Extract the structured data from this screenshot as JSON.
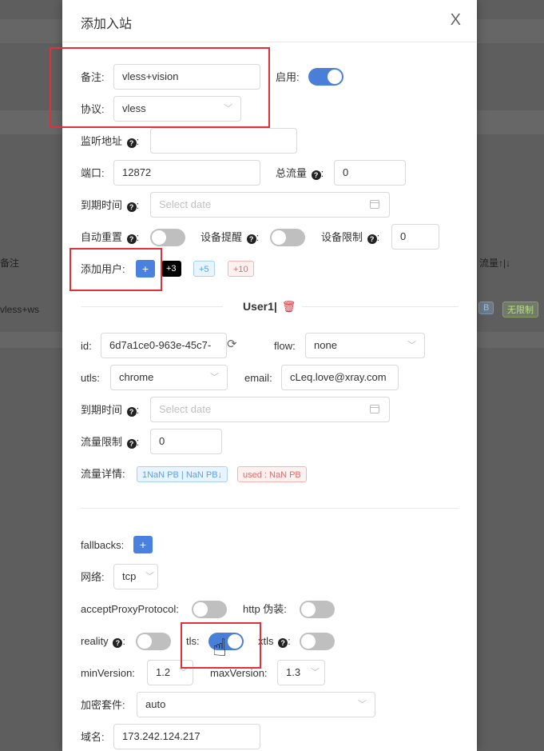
{
  "background": {
    "col_left_header": "备注",
    "col_right_header": "流量↑|↓",
    "row_left_value": "vless+ws",
    "row_tag_b": "B",
    "row_tag_unlimited": "无限制"
  },
  "modal": {
    "title": "添加入站",
    "close": "X",
    "remark_label": "备注:",
    "remark_value": "vless+vision",
    "enable_label": "启用:",
    "enable_on": true,
    "protocol_label": "协议:",
    "protocol_value": "vless",
    "listen_label": "监听地址",
    "listen_value": "",
    "port_label": "端口:",
    "port_value": "12872",
    "total_traffic_label": "总流量",
    "total_traffic_value": "0",
    "expiry_label": "到期时间",
    "expiry_placeholder": "Select date",
    "auto_reset_label": "自动重置",
    "device_alert_label": "设备提醒",
    "device_limit_label": "设备限制",
    "device_limit_value": "0",
    "add_user_label": "添加用户:",
    "add_btn": "+",
    "chip_plus3": "+3",
    "chip_plus5": "+5",
    "chip_plus10": "+10",
    "user_heading": "User1|",
    "id_label": "id:",
    "id_value": "6d7a1ce0-963e-45c7-",
    "flow_label": "flow:",
    "flow_value": "none",
    "utls_label": "utls:",
    "utls_value": "chrome",
    "email_label": "email:",
    "email_value": "cLeq.love@xray.com",
    "user_expiry_label": "到期时间",
    "user_expiry_placeholder": "Select date",
    "traffic_limit_label": "流量限制",
    "traffic_limit_value": "0",
    "traffic_detail_label": "流量详情:",
    "traffic_detail_chip": "1NaN PB | NaN PB↓",
    "used_chip": "used : NaN PB",
    "fallbacks_label": "fallbacks:",
    "network_label": "网络:",
    "network_value": "tcp",
    "accept_proxy_label": "acceptProxyProtocol:",
    "http_camouflage_label": "http 伪装:",
    "reality_label": "reality",
    "tls_label": "tls:",
    "xtls_label": "xtls",
    "min_version_label": "minVersion:",
    "min_version_value": "1.2",
    "max_version_label": "maxVersion:",
    "max_version_value": "1.3",
    "cipher_label": "加密套件:",
    "cipher_value": "auto",
    "domain_label": "域名:",
    "domain_value": "173.242.124.217"
  },
  "colors": {
    "accent": "#4a80df",
    "highlight": "#e0303a"
  }
}
